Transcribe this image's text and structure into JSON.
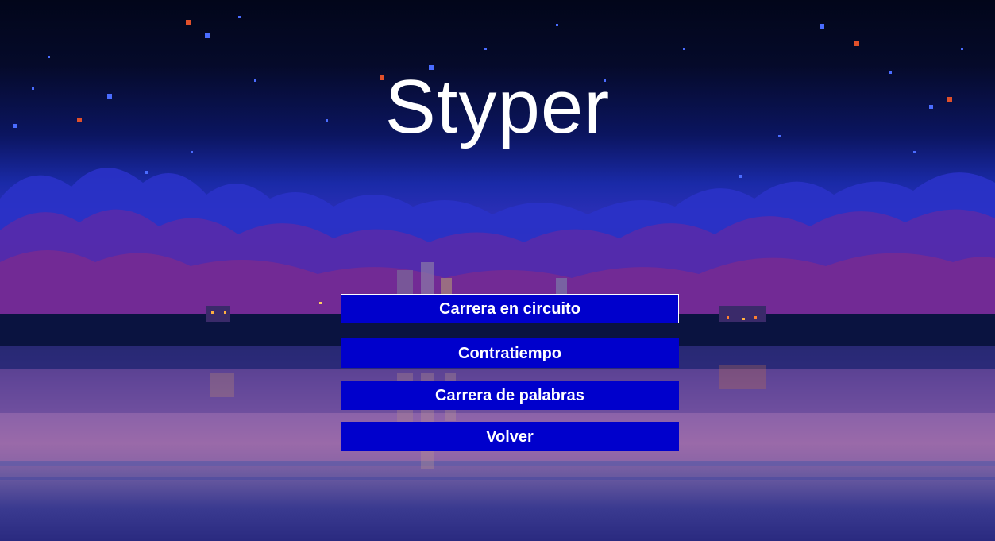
{
  "title": "Styper",
  "menu": {
    "items": [
      {
        "label": "Carrera en circuito",
        "selected": true
      },
      {
        "label": "Contratiempo",
        "selected": false
      },
      {
        "label": "Carrera de palabras",
        "selected": false
      },
      {
        "label": "Volver",
        "selected": false
      }
    ]
  },
  "colors": {
    "button_bg": "#0000cc",
    "button_text": "#ffffff",
    "title_text": "#ffffff",
    "selected_border": "#ffffff"
  },
  "icons": [
    "pixel-night-sky-background",
    "pixel-clouds",
    "pixel-city-lights",
    "water-reflection"
  ]
}
